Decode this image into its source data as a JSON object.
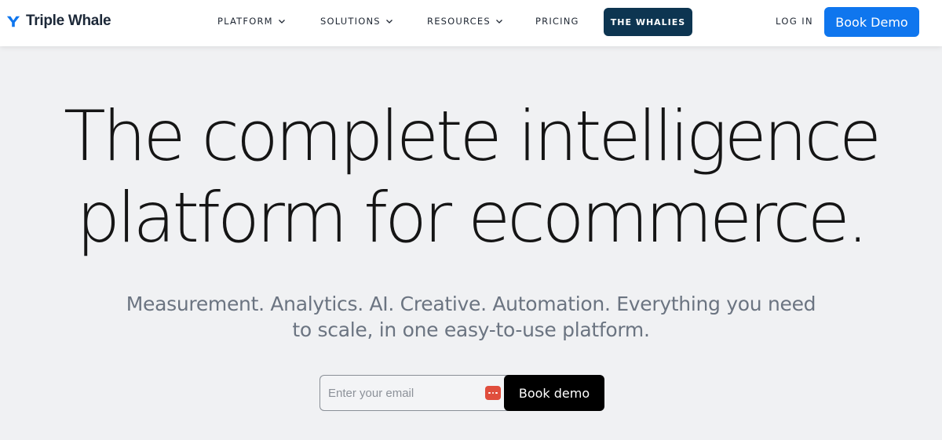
{
  "header": {
    "brand": "Triple Whale",
    "brand_color": "#0f76ee",
    "logo_icon": "triple-whale-logo-icon",
    "nav": [
      {
        "label": "PLATFORM",
        "icon": "chevron-down-icon"
      },
      {
        "label": "SOLUTIONS",
        "icon": "chevron-down-icon"
      },
      {
        "label": "RESOURCES",
        "icon": "chevron-down-icon"
      },
      {
        "label": "PRICING"
      }
    ],
    "whalies_label": "THE WHALIES",
    "whalies_color": "#0d3551",
    "login_label": "LOG IN",
    "book_demo_label": "Book Demo"
  },
  "hero": {
    "title_line1": "The complete intelligence",
    "title_line2": "platform for ecommerce.",
    "subtitle_line1": "Measurement. Analytics. AI. Creative. Automation. Everything you need",
    "subtitle_line2": "to scale, in one easy-to-use platform.",
    "email_placeholder": "Enter your email",
    "email_value": "",
    "password_manager_icon": "password-manager-icon",
    "cta_label": "Book demo"
  }
}
